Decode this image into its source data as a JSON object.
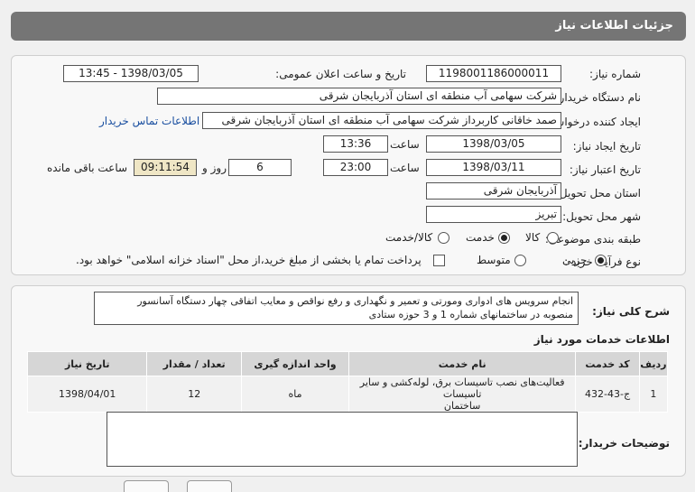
{
  "title": "جزئیات اطلاعات نیاز",
  "form": {
    "need_number_label": "شماره نیاز:",
    "need_number": "1198001186000011",
    "announce_label": "تاریخ و ساعت اعلان عمومی:",
    "announce_value": "1398/03/05 - 13:45",
    "buyer_org_label": "نام دستگاه خریدار:",
    "buyer_org": "شرکت سهامی آب منطقه ای استان آذربایجان شرقی",
    "requester_label": "ایجاد کننده درخواست:",
    "requester": "صمد خاقانی کاربرداز شرکت سهامی آب منطقه ای استان آذربایجان شرقی",
    "contact_link": "اطلاعات تماس خریدار",
    "created_label": "تاریخ ایجاد نیاز:",
    "created_date": "1398/03/05",
    "time_word": "ساعت",
    "created_time": "13:36",
    "validity_label": "تاریخ اعتبار نیاز:",
    "validity_date": "1398/03/11",
    "validity_time": "23:00",
    "days_value": "6",
    "days_word": "روز و",
    "remaining_time": "09:11:54",
    "remaining_label": "ساعت باقی مانده",
    "delivery_province_label": "استان محل تحویل:",
    "delivery_province": "آذربایجان شرقی",
    "delivery_city_label": "شهر محل تحویل:",
    "delivery_city": "تبریز",
    "category_label": "طبقه بندی موضوعی:",
    "category_options": [
      "کالا",
      "خدمت",
      "کالا/خدمت"
    ],
    "category_selected": "خدمت",
    "process_label": "نوع فرآیند خرید :",
    "process_options": [
      "جزیی",
      "متوسط"
    ],
    "process_selected": "جزیی",
    "payment_note": "پرداخت تمام یا بخشی از مبلغ خرید،از محل \"اسناد خزانه اسلامی\" خواهد بود."
  },
  "description": {
    "label": "شرح کلی نیاز:",
    "text_line1": "انجام سرویس های ادواری ومورتی و تعمیر و نگهداری و رفع نواقص و معایب اتفاقی چهار دستگاه آسانسور",
    "text_line2": "منصوبه در ساختمانهای شماره 1 و 3 حوزه ستادی"
  },
  "services": {
    "section_title": "اطلاعات خدمات مورد نیاز",
    "headers": [
      "ردیف",
      "کد خدمت",
      "نام خدمت",
      "واحد اندازه گیری",
      "تعداد / مقدار",
      "تاریخ نیاز"
    ],
    "rows": [
      {
        "row": "1",
        "code": "ج-43-432",
        "name_line1": "فعالیت‌های نصب تاسیسات برق، لوله‌کشی و سایر تاسیسات",
        "name_line2": "ساختمان",
        "unit": "ماه",
        "qty": "12",
        "date": "1398/04/01"
      }
    ]
  },
  "buyer_notes": {
    "label": "توضیحات خریدار:",
    "text": ""
  }
}
